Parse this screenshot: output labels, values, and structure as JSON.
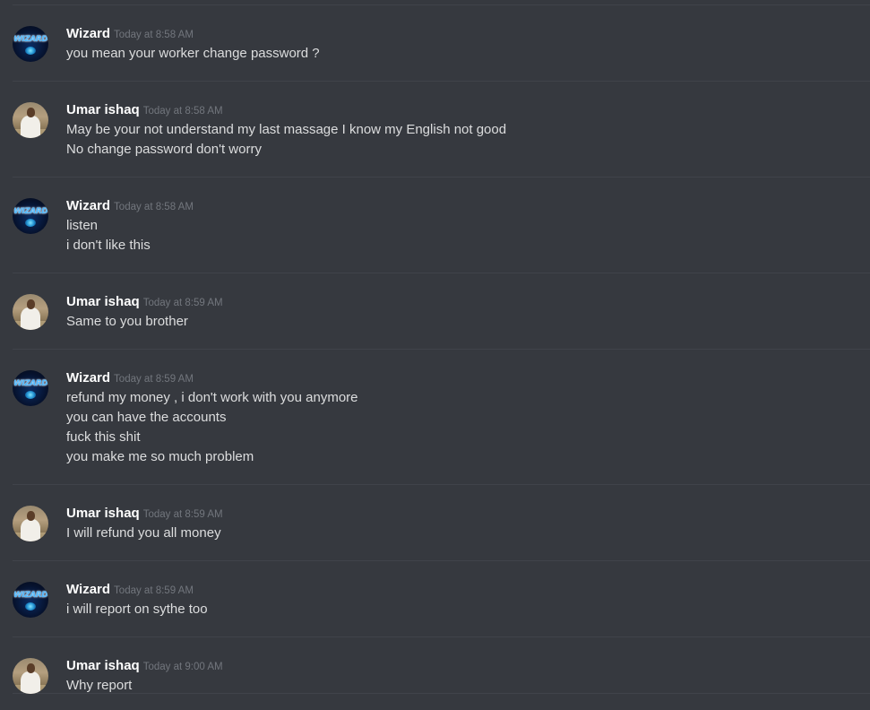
{
  "avatars": {
    "wizard": {
      "icon": "wizard-logo-avatar",
      "text": "WIZARD",
      "colors": [
        "#0b2c63",
        "#4fb8ff"
      ]
    },
    "umar": {
      "icon": "person-photo-avatar"
    }
  },
  "messages": [
    {
      "author": "Wizard",
      "avatar": "wizard",
      "timestamp": "Today at 8:58 AM",
      "lines": [
        "you mean your worker change password ?"
      ]
    },
    {
      "author": "Umar ishaq",
      "avatar": "umar",
      "timestamp": "Today at 8:58 AM",
      "lines": [
        "May be your not understand my last massage I know my English not good",
        "No change password don't worry"
      ]
    },
    {
      "author": "Wizard",
      "avatar": "wizard",
      "timestamp": "Today at 8:58 AM",
      "lines": [
        "listen",
        "i don't like this"
      ]
    },
    {
      "author": "Umar ishaq",
      "avatar": "umar",
      "timestamp": "Today at 8:59 AM",
      "lines": [
        "Same to you brother"
      ]
    },
    {
      "author": "Wizard",
      "avatar": "wizard",
      "timestamp": "Today at 8:59 AM",
      "lines": [
        "refund my money , i don't work with you anymore",
        "you can have the accounts",
        "fuck this shit",
        "you make me so much problem"
      ]
    },
    {
      "author": "Umar ishaq",
      "avatar": "umar",
      "timestamp": "Today at 8:59 AM",
      "lines": [
        "I will refund you all money"
      ]
    },
    {
      "author": "Wizard",
      "avatar": "wizard",
      "timestamp": "Today at 8:59 AM",
      "lines": [
        "i will report on sythe too"
      ]
    },
    {
      "author": "Umar ishaq",
      "avatar": "umar",
      "timestamp": "Today at 9:00 AM",
      "lines": [
        "Why report"
      ]
    }
  ]
}
